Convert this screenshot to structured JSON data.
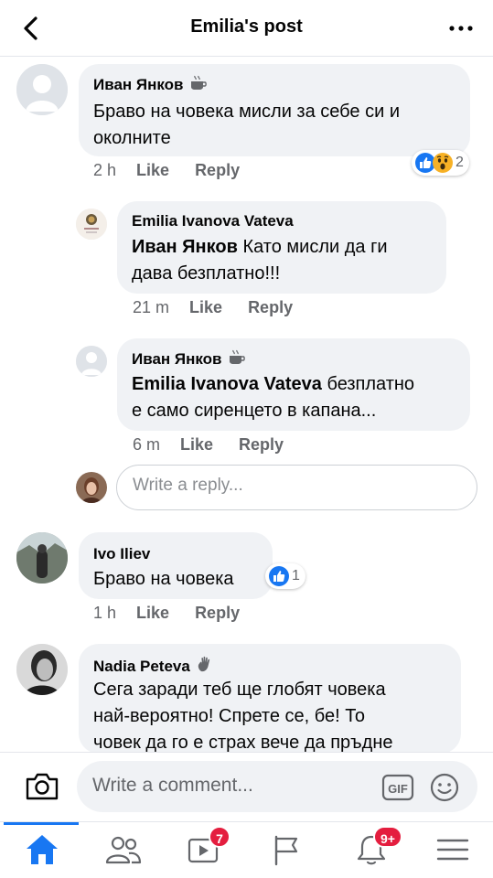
{
  "header": {
    "title": "Emilia's post",
    "back_icon": "chevron-left-icon",
    "more_icon": "more-horizontal-icon"
  },
  "comments": [
    {
      "name": "Иван Янков",
      "badge": "coffee-cup-icon",
      "text_lines": [
        "Браво на човека мисли за себе си и",
        "околните"
      ],
      "time": "2 h",
      "like": "Like",
      "reply": "Reply",
      "reactions": {
        "types": [
          "like",
          "wow"
        ],
        "count": "2"
      }
    },
    {
      "name": "Emilia Ivanova Vateva",
      "mention": "Иван Янков",
      "text_lines": [
        " Като мисли да ги",
        "дава безплатно!!!"
      ],
      "time": "21 m",
      "like": "Like",
      "reply": "Reply"
    },
    {
      "name": "Иван Янков",
      "badge": "coffee-cup-icon",
      "mention": "Emilia Ivanova Vateva",
      "text_lines": [
        " безплатно",
        "е само сиренцето в капана..."
      ],
      "time": "6 m",
      "like": "Like",
      "reply": "Reply"
    },
    {
      "name": "Ivo Iliev",
      "text_lines": [
        "Браво на човека"
      ],
      "time": "1 h",
      "like": "Like",
      "reply": "Reply",
      "reactions": {
        "types": [
          "like"
        ],
        "count": "1"
      }
    },
    {
      "name": "Nadia Peteva",
      "badge": "waving-hand-icon",
      "text_lines": [
        "Сега заради теб ще глобят човека",
        "най-вероятно! Спрете се, бе! То",
        "човек да го е страх вече да пръдне"
      ]
    }
  ],
  "reply_box": {
    "placeholder": "Write a reply..."
  },
  "composer": {
    "placeholder": "Write a comment...",
    "gif_label": "GIF"
  },
  "tabbar": {
    "watch_badge": "7",
    "notifications_badge": "9+"
  },
  "colors": {
    "accent": "#1877f2",
    "badge_red": "#e41e3f",
    "bubble": "#f0f2f5",
    "meta_gray": "#65676b"
  }
}
